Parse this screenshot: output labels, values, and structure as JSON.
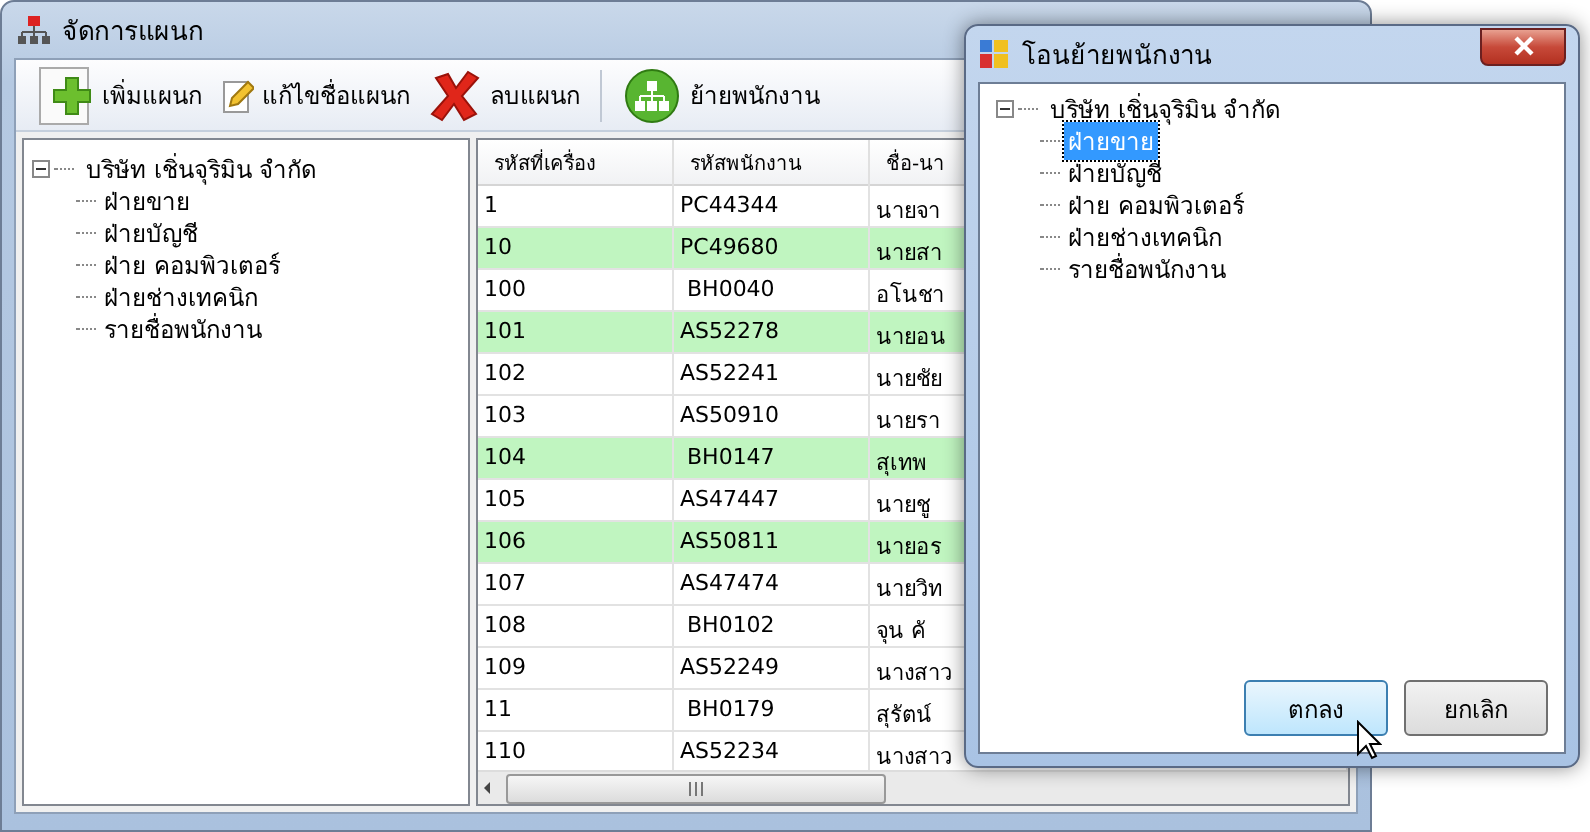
{
  "window": {
    "title": "จัดการแผนก"
  },
  "toolbar": [
    {
      "kind": "add",
      "label": "เพิ่มแผนก"
    },
    {
      "kind": "edit",
      "label": "แก้ไขชื่อแผนก"
    },
    {
      "kind": "delete",
      "label": "ลบแผนก"
    },
    {
      "kind": "move",
      "label": "ย้ายพนักงาน"
    }
  ],
  "tree": {
    "label": "บริษัท เชิ่นจุริมิน จำกัด",
    "expanded": true,
    "children": [
      {
        "label": "ฝ่ายขาย",
        "selected": false
      },
      {
        "label": "ฝ่ายบัญชี",
        "selected": false
      },
      {
        "label": "ฝ่าย คอมพิวเตอร์",
        "selected": false
      },
      {
        "label": "ฝ่ายช่างเทคนิก",
        "selected": false
      },
      {
        "label": "รายชื่อพนักงาน",
        "selected": false
      }
    ]
  },
  "table": {
    "columns": [
      "รหัสที่เครื่อง",
      "รหัสพนักงาน",
      "ชื่อ-นา"
    ],
    "rows": [
      {
        "cells": [
          "1",
          "PC44344",
          "นายจา"
        ],
        "shaded": false
      },
      {
        "cells": [
          "10",
          "PC49680",
          "นายสา"
        ],
        "shaded": true
      },
      {
        "cells": [
          "100",
          " BH0040",
          "อโนชา"
        ],
        "shaded": false
      },
      {
        "cells": [
          "101",
          "AS52278",
          "นายอน"
        ],
        "shaded": true
      },
      {
        "cells": [
          "102",
          "AS52241",
          "นายชัย"
        ],
        "shaded": false
      },
      {
        "cells": [
          "103",
          "AS50910",
          "นายรา"
        ],
        "shaded": false
      },
      {
        "cells": [
          "104",
          " BH0147",
          "สุเทพ"
        ],
        "shaded": true
      },
      {
        "cells": [
          "105",
          "AS47447",
          "นายชู"
        ],
        "shaded": false
      },
      {
        "cells": [
          "106",
          "AS50811",
          "นายอร"
        ],
        "shaded": true
      },
      {
        "cells": [
          "107",
          "AS47474",
          "นายวิท"
        ],
        "shaded": false
      },
      {
        "cells": [
          "108",
          " BH0102",
          "จุน คั"
        ],
        "shaded": false
      },
      {
        "cells": [
          "109",
          "AS52249",
          "นางสาว"
        ],
        "shaded": false
      },
      {
        "cells": [
          "11",
          " BH0179",
          "สุรัตน์"
        ],
        "shaded": false
      },
      {
        "cells": [
          "110",
          "AS52234",
          "นางสาว"
        ],
        "shaded": false
      }
    ]
  },
  "dialog": {
    "title": "โอนย้ายพนักงาน",
    "tree": {
      "label": "บริษัท เชิ่นจุริมิน จำกัด",
      "expanded": true,
      "children": [
        {
          "label": "ฝ่ายขาย",
          "selected": true
        },
        {
          "label": "ฝ่ายบัญชี",
          "selected": false
        },
        {
          "label": "ฝ่าย คอมพิวเตอร์",
          "selected": false
        },
        {
          "label": "ฝ่ายช่างเทคนิก",
          "selected": false
        },
        {
          "label": "รายชื่อพนักงาน",
          "selected": false
        }
      ]
    },
    "buttons": [
      {
        "label": "ตกลง",
        "hovered": true
      },
      {
        "label": "ยกเลิก",
        "hovered": false
      }
    ]
  }
}
